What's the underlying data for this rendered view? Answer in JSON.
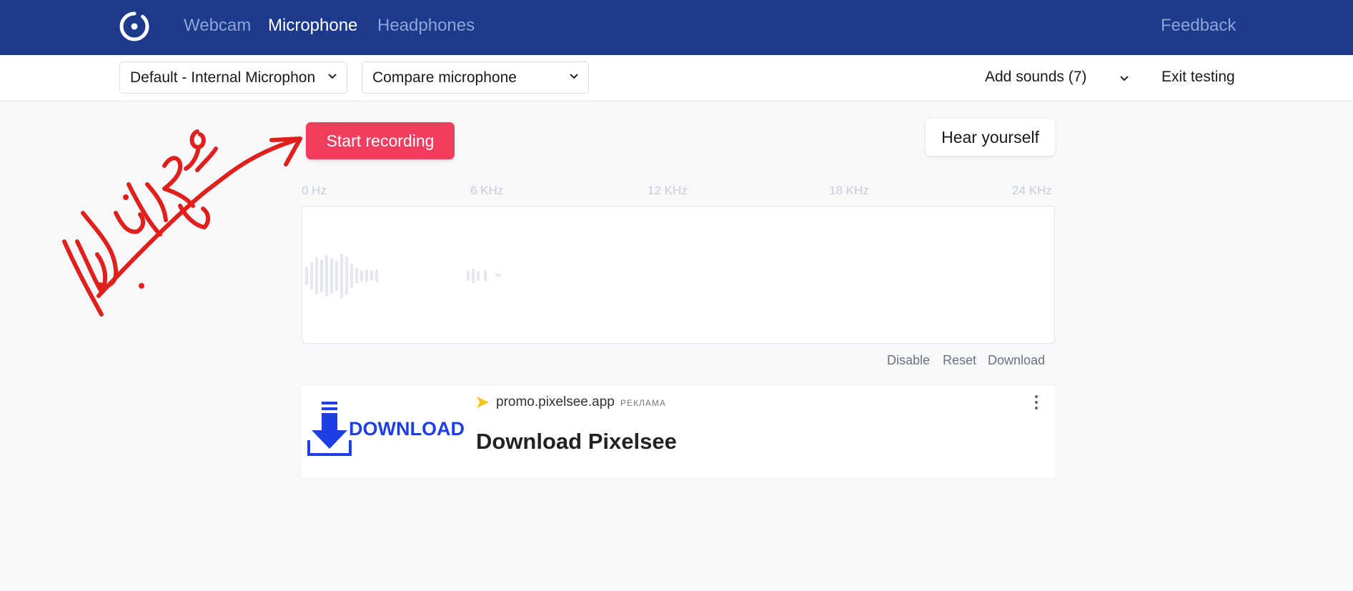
{
  "nav": {
    "links": [
      {
        "label": "Webcam",
        "active": false
      },
      {
        "label": "Microphone",
        "active": true
      },
      {
        "label": "Headphones",
        "active": false
      }
    ],
    "feedback_label": "Feedback",
    "logo_icon": "target-ring-icon"
  },
  "toolbar": {
    "mic_select": {
      "value": "Default - Internal Microphon"
    },
    "compare_select": {
      "value": "Compare microphone"
    },
    "add_sounds_label": "Add sounds (7)",
    "exit_label": "Exit testing"
  },
  "main": {
    "start_recording_label": "Start recording",
    "hear_yourself_label": "Hear yourself",
    "frequency_labels": [
      "0 Hz",
      "6 KHz",
      "12 KHz",
      "18 KHz",
      "24 KHz"
    ],
    "actions": {
      "disable": "Disable",
      "reset": "Reset",
      "download": "Download"
    }
  },
  "ad": {
    "image_text": "DOWNLOAD",
    "domain": "promo.pixelsee.app",
    "tag": "РЕКЛАМА",
    "title": "Download Pixelsee"
  },
  "colors": {
    "nav_bg": "#1d3a8c",
    "accent_button": "#f23d5f",
    "ad_blue": "#1e3ee6",
    "annotation_red": "#e0201c"
  }
}
